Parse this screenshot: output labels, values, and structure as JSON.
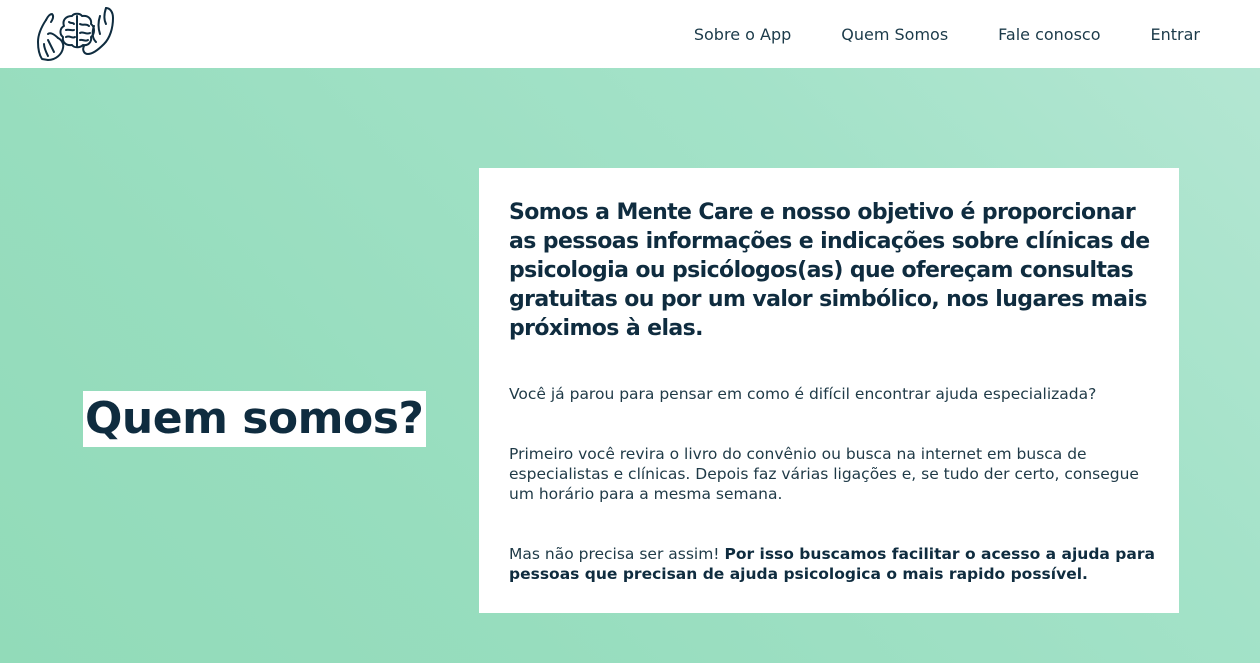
{
  "header": {
    "logo_icon": "hands-holding-brain-icon",
    "nav": [
      {
        "label": "Sobre o App"
      },
      {
        "label": "Quem Somos"
      },
      {
        "label": "Fale conosco"
      },
      {
        "label": "Entrar"
      }
    ]
  },
  "hero": {
    "title": "Quem somos?",
    "lead": "Somos a Mente Care e nosso objetivo é proporcionar as pessoas informações e indicações sobre clínicas de psicologia ou psicólogos(as) que ofereçam consultas gratuitas ou por um valor simbólico, nos lugares mais próximos à elas.",
    "paragraph1": "Você já parou para pensar em como é difícil encontrar ajuda especializada?",
    "paragraph2": "Primeiro você revira o livro do convênio ou busca na internet em busca de especialistas e clínicas. Depois faz várias ligações e, se tudo der certo, consegue um horário para a mesma semana.",
    "paragraph3_plain": "Mas não precisa ser assim! ",
    "paragraph3_bold": "Por isso buscamos facilitar o acesso a ajuda para pessoas que precisan de ajuda psicologica o mais rapido possível."
  },
  "colors": {
    "accent_text": "#0f2c3f",
    "background_gradient_start": "#b3e6d2",
    "background_gradient_end": "#92dbb9",
    "card_background": "#ffffff"
  }
}
